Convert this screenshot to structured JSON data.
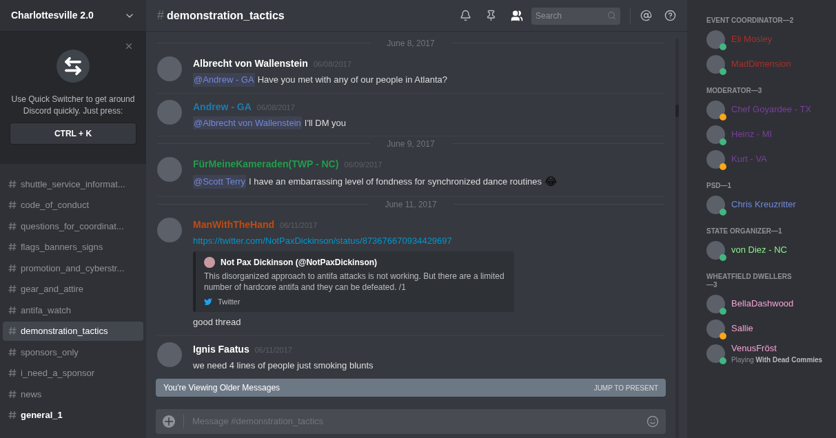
{
  "server": {
    "name": "Charlottesville 2.0"
  },
  "quick_switcher": {
    "text": "Use Quick Switcher to get around Discord quickly. Just press:",
    "shortcut": "CTRL + K"
  },
  "channels": [
    {
      "name": "shuttle_service_informat...",
      "selected": false,
      "unread": false
    },
    {
      "name": "code_of_conduct",
      "selected": false,
      "unread": false
    },
    {
      "name": "questions_for_coordinat...",
      "selected": false,
      "unread": false
    },
    {
      "name": "flags_banners_signs",
      "selected": false,
      "unread": false
    },
    {
      "name": "promotion_and_cyberstr...",
      "selected": false,
      "unread": false
    },
    {
      "name": "gear_and_attire",
      "selected": false,
      "unread": false
    },
    {
      "name": "antifa_watch",
      "selected": false,
      "unread": false
    },
    {
      "name": "demonstration_tactics",
      "selected": true,
      "unread": false
    },
    {
      "name": "sponsors_only",
      "selected": false,
      "unread": false
    },
    {
      "name": "i_need_a_sponsor",
      "selected": false,
      "unread": false
    },
    {
      "name": "news",
      "selected": false,
      "unread": false
    },
    {
      "name": "general_1",
      "selected": false,
      "unread": true
    }
  ],
  "header": {
    "hash": "#",
    "channel": "demonstration_tactics",
    "search_placeholder": "Search"
  },
  "messages": [
    {
      "kind": "divider",
      "date": "June 8, 2017"
    },
    {
      "kind": "message",
      "author": "Albrecht von Wallenstein",
      "color": "#ffffff",
      "time": "06/08/2017",
      "mention": "@Andrew - GA",
      "text": "Have you met with any of our people in Atlanta?"
    },
    {
      "kind": "message",
      "author": "Andrew - GA",
      "color": "#1f7bb0",
      "time": "06/08/2017",
      "mention": "@Albrecht von Wallenstein",
      "text": "I'll DM you"
    },
    {
      "kind": "divider",
      "date": "June 9, 2017"
    },
    {
      "kind": "message",
      "author": "FürMeineKameraden(TWP - NC)",
      "color": "#1f9e4a",
      "time": "06/09/2017",
      "mention": "@Scott Terry",
      "text": "I have an embarrassing level of fondness for synchronized dance routines",
      "emoji": "😂"
    },
    {
      "kind": "divider",
      "date": "June 11, 2017"
    },
    {
      "kind": "message",
      "author": "ManWithTheHand",
      "color": "#c14b12",
      "time": "06/11/2017",
      "link": "https://twitter.com/NotPaxDickinson/status/873676670934429697",
      "embed": {
        "author": "Not Pax Dickinson (@NotPaxDickinson)",
        "text": "This disorganized approach to antifa attacks is not working. But there are a limited number of hardcore antifa and they can be defeated. /1",
        "footer": "Twitter"
      },
      "text": "good thread"
    },
    {
      "kind": "message",
      "author": "Ignis Faatus",
      "color": "#ffffff",
      "time": "06/11/2017",
      "text": "we need 4 lines of people just smoking blunts"
    }
  ],
  "older_bar": {
    "text": "You're Viewing Older Messages",
    "action": "JUMP TO PRESENT"
  },
  "composer": {
    "placeholder": "Message #demonstration_tactics"
  },
  "members": [
    {
      "role": "EVENT COORDINATOR—2",
      "color": "#a8302a",
      "users": [
        {
          "name": "Eli Mosley",
          "color": "#43b581"
        },
        {
          "name": "MadDimension",
          "color": "#43b581"
        }
      ]
    },
    {
      "role": "MODERATOR—3",
      "color": "#7a3e9d",
      "users": [
        {
          "name": "Chef Goyardee - TX",
          "color": "#faa61a"
        },
        {
          "name": "Heinz - MI",
          "color": "#43b581"
        },
        {
          "name": "Kurt - VA",
          "color": "#faa61a"
        }
      ]
    },
    {
      "role": "PSD—1",
      "color": "#7289da",
      "users": [
        {
          "name": "Chris Kreuzritter",
          "color": "#43b581"
        }
      ]
    },
    {
      "role": "STATE ORGANIZER—1",
      "color": "#8ff08f",
      "users": [
        {
          "name": "von Diez - NC",
          "color": "#43b581"
        }
      ]
    },
    {
      "role": "WHEATFIELD DWELLERS—3",
      "color": "#f4a4d4",
      "users": [
        {
          "name": "BellaDashwood",
          "color": "#43b581"
        },
        {
          "name": "Sallie",
          "color": "#faa61a"
        },
        {
          "name": "VenusFröst",
          "color": "#43b581",
          "activity_prefix": "Playing",
          "activity": "With Dead Commies"
        }
      ]
    }
  ]
}
